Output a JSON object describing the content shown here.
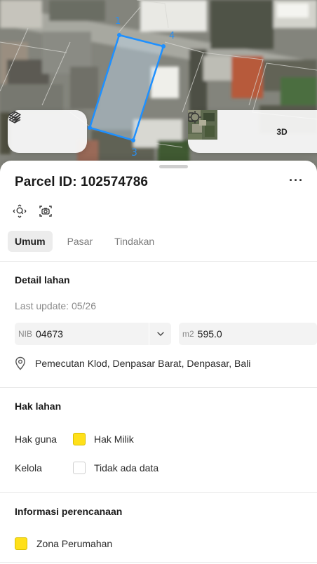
{
  "map": {
    "vertex_labels": [
      "1",
      "4",
      "3"
    ],
    "left_controls": [
      {
        "icon": "layers-icon"
      },
      {
        "icon": "draw-icon"
      }
    ],
    "right_controls": {
      "satellite_icon": "satellite-thumbnail-icon",
      "locate_icon": "crosshair-icon",
      "three_d_label": "3D",
      "frame_icon": "frame-icon"
    },
    "parcel_color": "#1e90ff"
  },
  "sheet": {
    "title": "Parcel ID: 102574786",
    "more_label": "···",
    "tabs": [
      {
        "label": "Umum",
        "active": true
      },
      {
        "label": "Pasar",
        "active": false
      },
      {
        "label": "Tindakan",
        "active": false
      }
    ],
    "land_detail": {
      "title": "Detail lahan",
      "last_update": "Last update: 05/26",
      "nib_prefix": "NIB",
      "nib_value": "04673",
      "area_prefix": "m2",
      "area_value": "595.0",
      "address": "Pemecutan Klod, Denpasar Barat, Denpasar, Bali"
    },
    "land_rights": {
      "title": "Hak lahan",
      "rows": [
        {
          "label": "Hak guna",
          "value": "Hak Milik",
          "swatch": "#ffe01a"
        },
        {
          "label": "Kelola",
          "value": "Tidak ada data",
          "swatch": "#ffffff"
        }
      ]
    },
    "planning": {
      "title": "Informasi perencanaan",
      "zone": "Zona Perumahan",
      "zone_color": "#ffe01a"
    }
  }
}
